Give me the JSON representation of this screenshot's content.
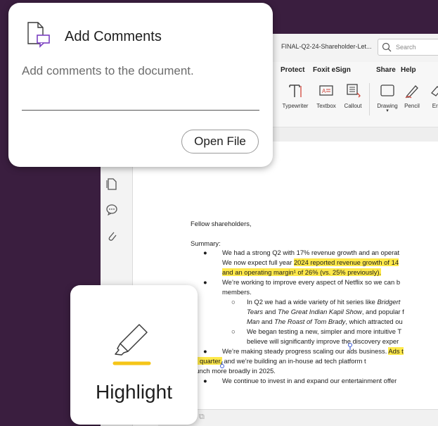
{
  "colors": {
    "background": "#3a1e3f",
    "accent": "#7b3fc1",
    "highlight": "#ffe94a",
    "highlighter_stroke": "#f5c518"
  },
  "app": {
    "doc_title": "FINAL-Q2-24-Shareholder-Let...",
    "search_placeholder": "Search",
    "menu": [
      "Protect",
      "Foxit eSign",
      "Share",
      "Help"
    ],
    "tools": [
      {
        "label": "Typewriter",
        "icon": "typewriter-icon"
      },
      {
        "label": "Textbox",
        "icon": "textbox-icon"
      },
      {
        "label": "Callout",
        "icon": "callout-icon"
      },
      {
        "label": "Drawing",
        "icon": "drawing-icon"
      },
      {
        "label": "Pencil",
        "icon": "pencil-icon"
      },
      {
        "label": "Era",
        "icon": "eraser-icon"
      }
    ],
    "left_icons": [
      "pages-icon",
      "comments-icon",
      "attachment-icon"
    ]
  },
  "document": {
    "greeting": "Fellow shareholders,",
    "summary_label": "Summary:",
    "lines": [
      {
        "type": "bullet",
        "text": "We had a strong Q2 with 17% revenue growth and an operat"
      },
      {
        "type": "cont",
        "text_pre": "We now expect full year ",
        "text_hl": "2024 reported revenue growth of 14"
      },
      {
        "type": "cont-hl",
        "text": "and an operating margin¹ of 26% (vs. 25% previously)."
      },
      {
        "type": "bullet",
        "text": "We’re working to improve every aspect of Netflix so we can b"
      },
      {
        "type": "cont",
        "text_pre": "members.",
        "text_hl": ""
      },
      {
        "type": "sub",
        "text_pre": "In Q2 we had a wide variety of hit series like ",
        "text_it": "Bridgert"
      },
      {
        "type": "sub-cont",
        "text_it1": "Tears",
        "text_mid": " and ",
        "text_it2": "The Great Indian Kapil Show",
        "text_post": ", and popular f"
      },
      {
        "type": "sub-cont",
        "text_it1": "Man",
        "text_mid": " and ",
        "text_it2": "The Roast of Tom Brady",
        "text_post": ", which attracted ou"
      },
      {
        "type": "sub",
        "text_pre": "We began testing a new, simpler and more intuitive T",
        "text_it": ""
      },
      {
        "type": "sub-cont-plain",
        "text": "believe will significantly improve the discovery exper"
      },
      {
        "type": "bullet-hl",
        "text_pre": "We’re making steady progress scaling our ads business. ",
        "text_hl": "Ads t"
      },
      {
        "type": "cont-mixed",
        "text_hl": "on quarter,",
        "text_post": " and we’re building an in-house ad tech platform t"
      },
      {
        "type": "cont",
        "text_pre": "launch more broadly in 2025.",
        "text_hl": ""
      },
      {
        "type": "bullet",
        "text": "We continue to invest in and expand our entertainment offer"
      }
    ]
  },
  "comments_card": {
    "title": "Add Comments",
    "description": "Add comments to the document.",
    "button": "Open File"
  },
  "highlight_card": {
    "label": "Highlight"
  }
}
